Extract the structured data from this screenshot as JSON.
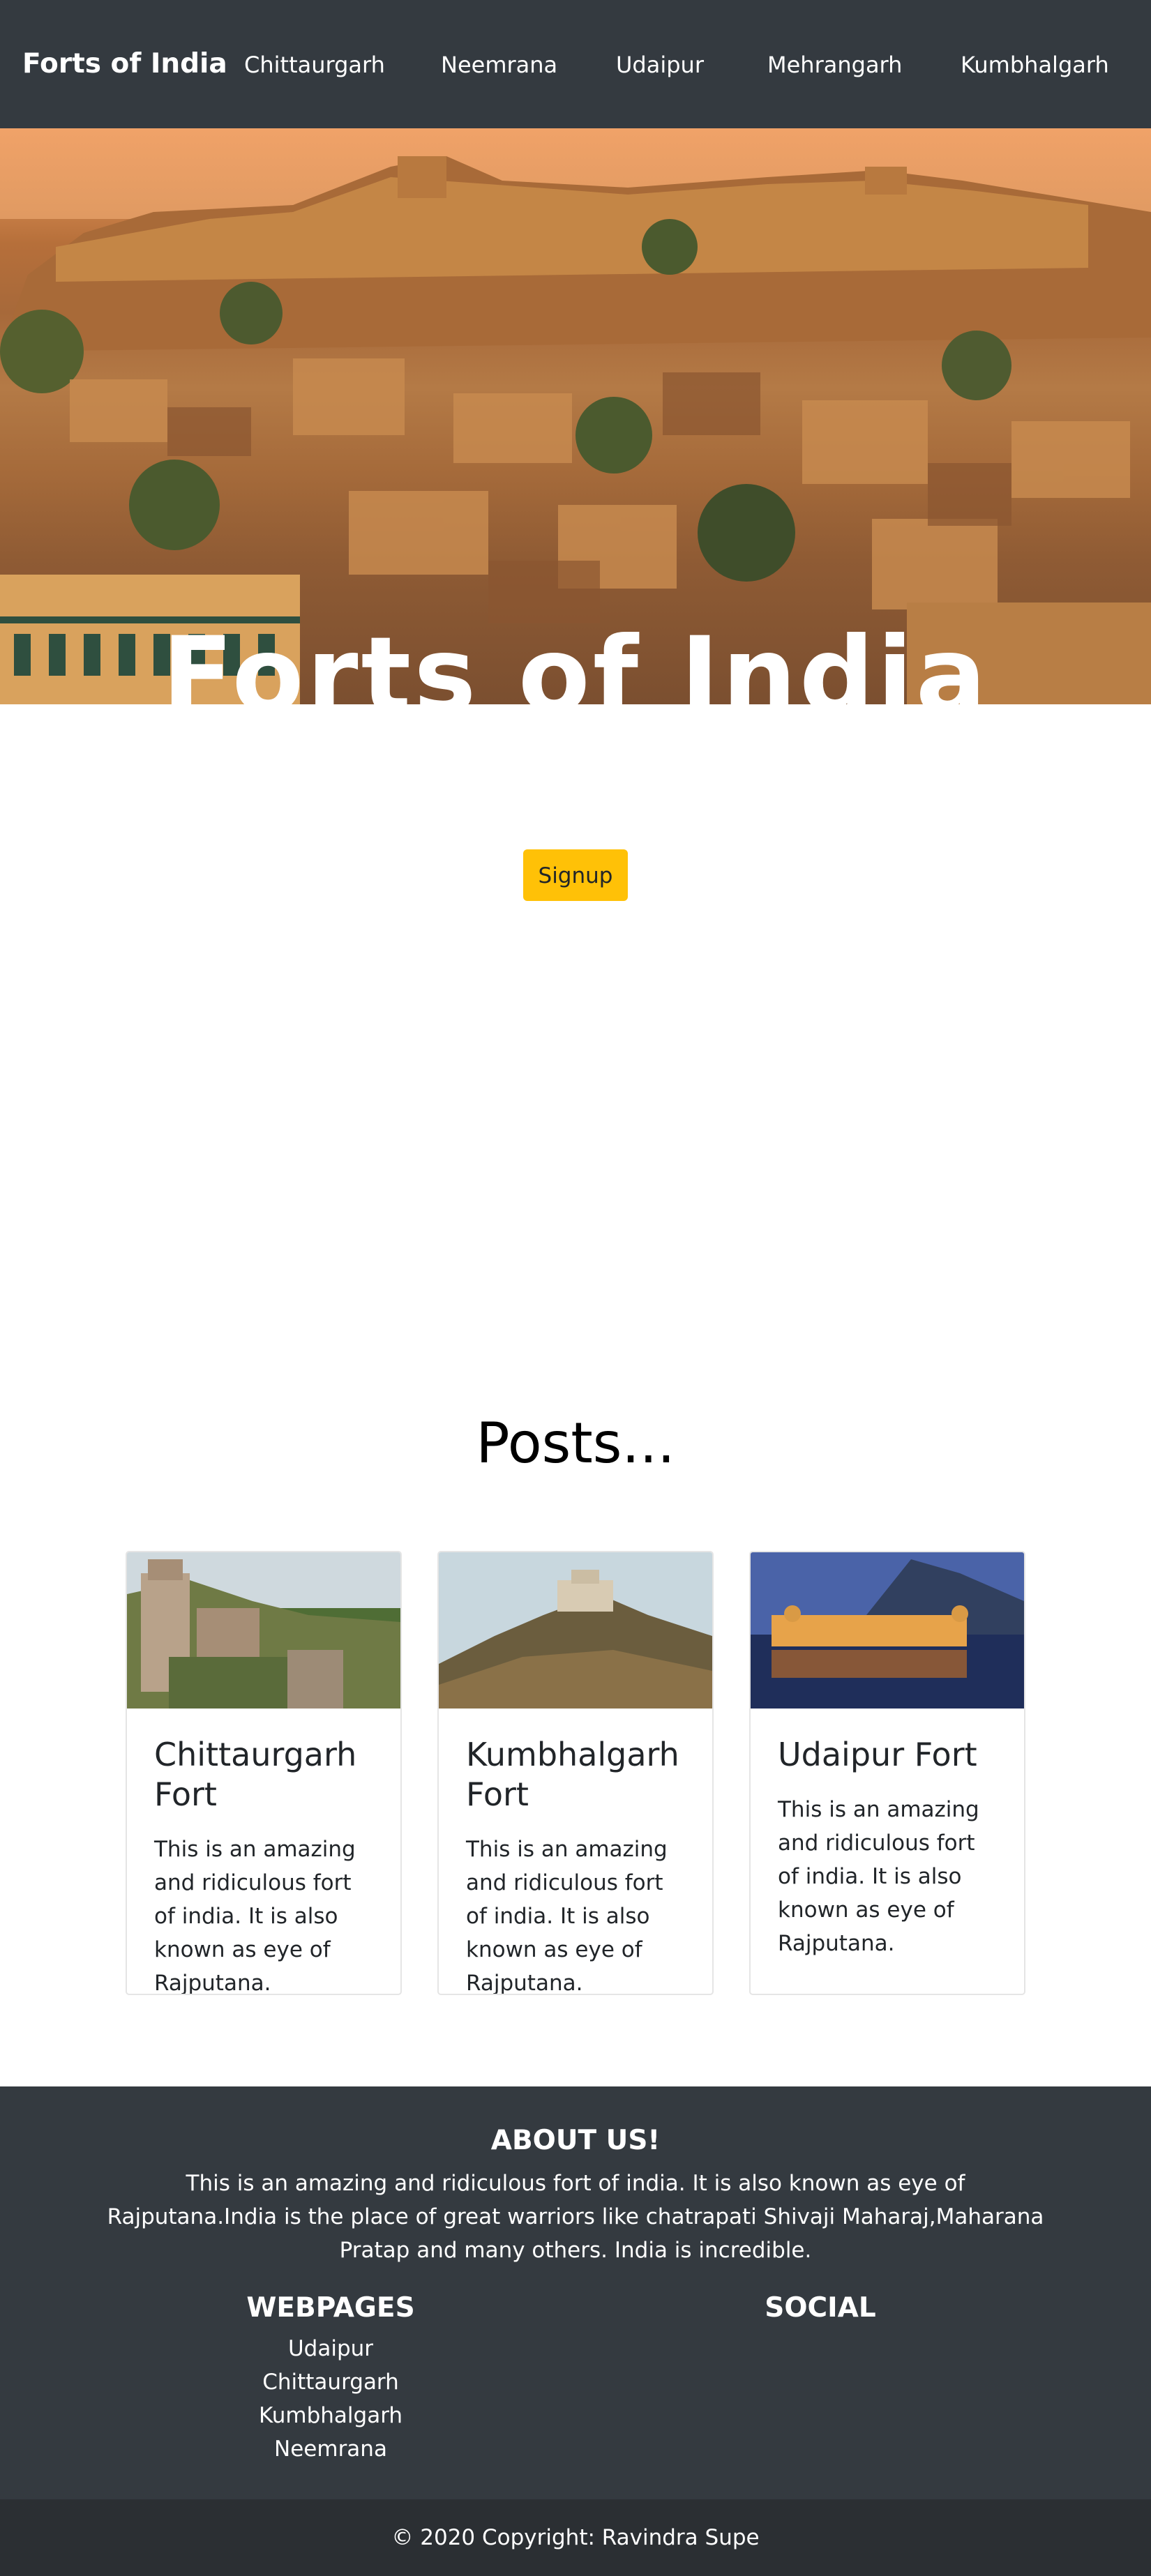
{
  "navbar": {
    "brand": "Forts of India",
    "links": [
      "Chittaurgarh",
      "Neemrana",
      "Udaipur",
      "Mehrangarh",
      "Kumbhalgarh"
    ]
  },
  "hero": {
    "title": "Forts of India",
    "signup_label": "Signup"
  },
  "posts": {
    "heading": "Posts...",
    "cards": [
      {
        "title": "Chittaurgarh Fort",
        "text": "This is an amazing and ridiculous fort of india. It is also known as eye of Rajputana."
      },
      {
        "title": "Kumbhalgarh Fort",
        "text": "This is an amazing and ridiculous fort of india. It is also known as eye of Rajputana."
      },
      {
        "title": "Udaipur Fort",
        "text": "This is an amazing and ridiculous fort of india. It is also known as eye of Rajputana."
      }
    ]
  },
  "footer": {
    "about_title": "ABOUT US!",
    "about_text": "This is an amazing and ridiculous fort of india. It is also known as eye of Rajputana.India is the place of great warriors like chatrapati Shivaji Maharaj,Maharana Pratap and many others. India is incredible.",
    "webpages_title": "WEBPAGES",
    "webpages": [
      "Udaipur",
      "Chittaurgarh",
      "Kumbhalgarh",
      "Neemrana"
    ],
    "social_title": "SOCIAL",
    "copyright": "© 2020 Copyright: Ravindra Supe"
  },
  "colors": {
    "navbar": "#343a40",
    "signup": "#ffc107",
    "footer": "#343a40",
    "copyright_bar": "#2b2f33"
  }
}
